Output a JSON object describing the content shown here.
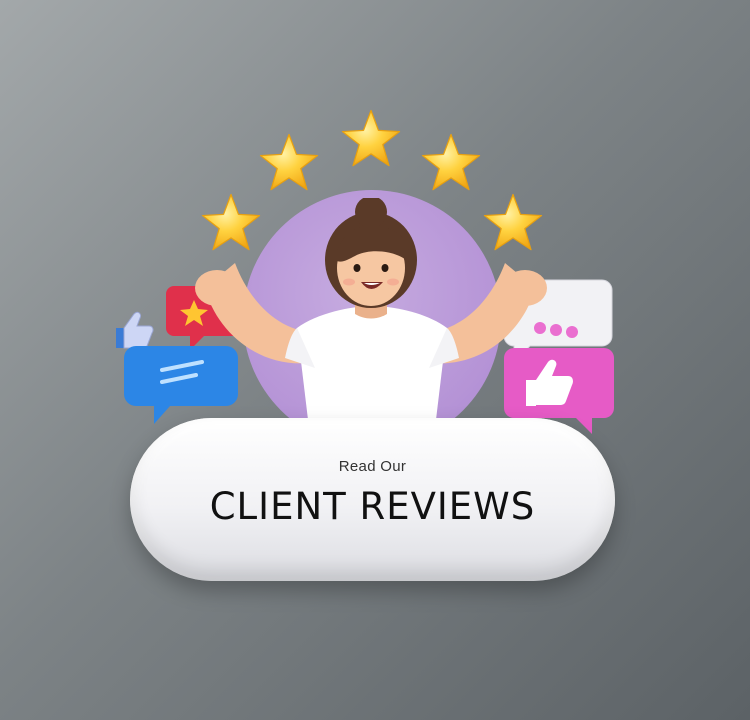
{
  "banner": {
    "kicker": "Read Our",
    "headline": "CLIENT REVIEWS"
  },
  "rating": {
    "stars": 5,
    "max": 5
  },
  "colors": {
    "star": "#ffc531",
    "circle": "#b593d6",
    "red_bubble": "#e0304b",
    "blue_bubble": "#2c86e6",
    "pink_bubble": "#e65bc6",
    "white_bubble": "#f2f2f5"
  },
  "icons": [
    "star-icon",
    "thumbs-up-icon",
    "chat-bubble-icon"
  ]
}
